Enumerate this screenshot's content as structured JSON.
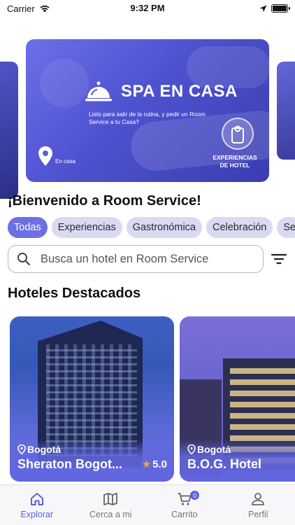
{
  "status_bar": {
    "carrier": "Carrier",
    "time": "9:32 PM"
  },
  "banner": {
    "title": "SPA EN CASA",
    "subtitle": "Listo para salir de la rutina, y pedir un Room Service a tu Casa?",
    "location": "En casa",
    "category": "EXPERIENCIAS DE HOTEL"
  },
  "welcome": "¡Bienvenido a Room Service!",
  "categories": [
    {
      "label": "Todas",
      "active": true
    },
    {
      "label": "Experiencias",
      "active": false
    },
    {
      "label": "Gastronómica",
      "active": false
    },
    {
      "label": "Celebración",
      "active": false
    },
    {
      "label": "Se",
      "active": false
    }
  ],
  "search": {
    "placeholder": "Busca un hotel en Room Service"
  },
  "featured": {
    "title": "Hoteles Destacados",
    "hotels": [
      {
        "city": "Bogotá",
        "name": "Sheraton Bogot...",
        "rating": "5.0"
      },
      {
        "city": "Bogotá",
        "name": "B.O.G. Hotel"
      }
    ]
  },
  "tabs": [
    {
      "label": "Explorar",
      "icon": "home-icon",
      "active": true
    },
    {
      "label": "Cerca a mi",
      "icon": "map-icon",
      "active": false
    },
    {
      "label": "Carrito",
      "icon": "cart-icon",
      "active": false,
      "badge": "0"
    },
    {
      "label": "Perfil",
      "icon": "person-icon",
      "active": false
    }
  ],
  "colors": {
    "accent": "#6c70e0",
    "chip_bg": "#d9daf2",
    "tab_active": "#5b60d9",
    "star": "#f5a623"
  }
}
